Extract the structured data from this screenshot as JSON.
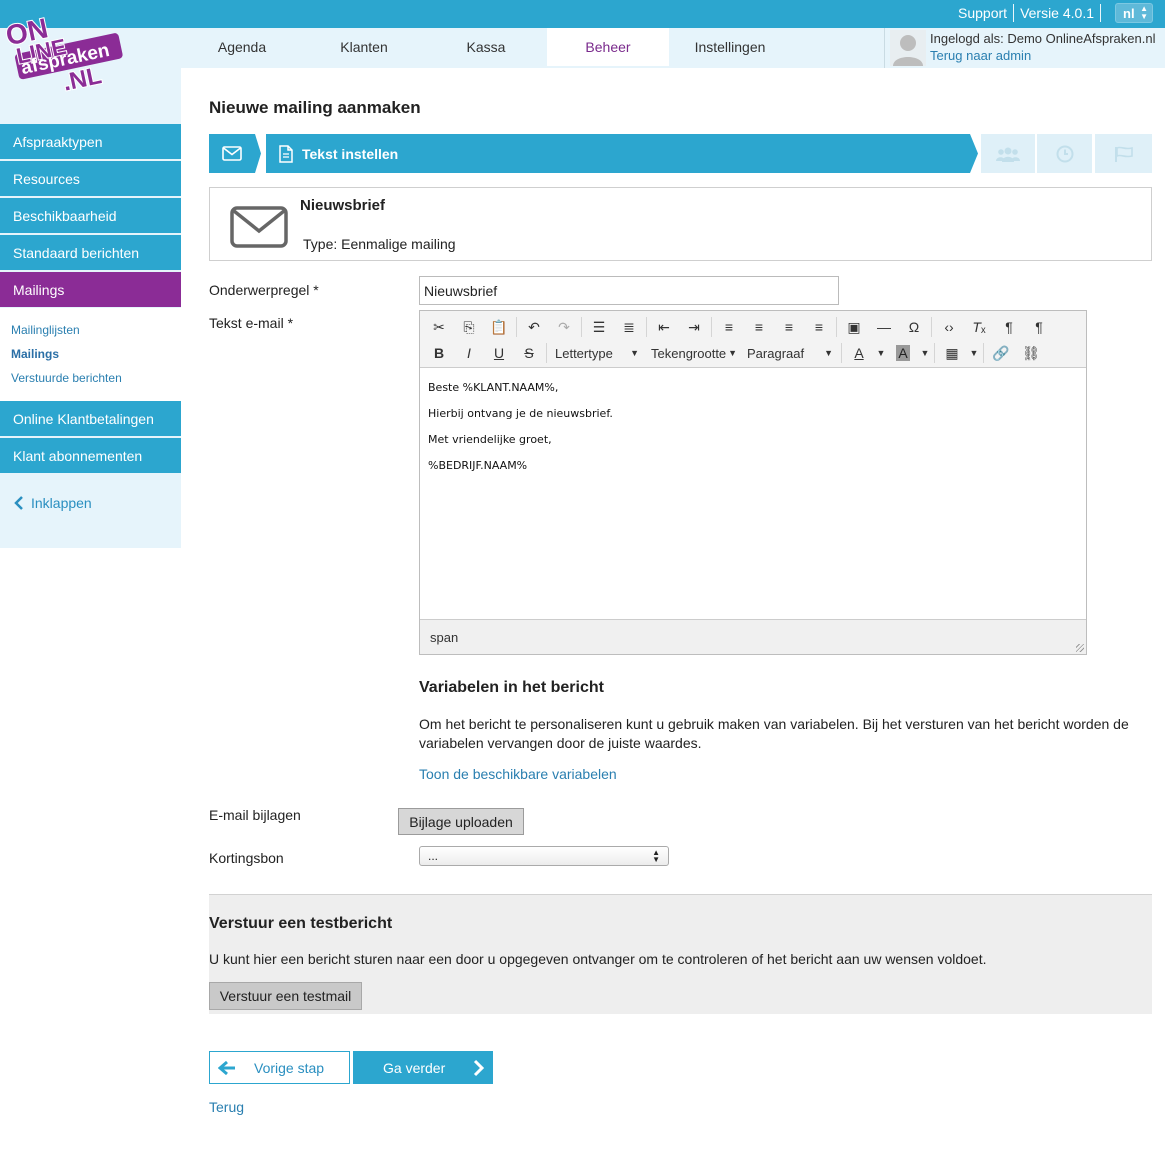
{
  "topbar": {
    "support": "Support",
    "version": "Versie 4.0.1",
    "language": "nl"
  },
  "logo": {
    "line1": "ON",
    "line2": "LINE",
    "line3": "afspraken",
    "line4": ".NL"
  },
  "nav": {
    "tabs": [
      {
        "label": "Agenda"
      },
      {
        "label": "Klanten"
      },
      {
        "label": "Kassa"
      },
      {
        "label": "Beheer"
      },
      {
        "label": "Instellingen"
      }
    ],
    "active": "Beheer"
  },
  "user": {
    "logged_in": "Ingelogd als: Demo OnlineAfspraken.nl",
    "back_to_admin": "Terug naar admin"
  },
  "sidebar": {
    "items": [
      {
        "label": "Afspraaktypen"
      },
      {
        "label": "Resources"
      },
      {
        "label": "Beschikbaarheid"
      },
      {
        "label": "Standaard berichten"
      },
      {
        "label": "Mailings"
      },
      {
        "label": "Online Klantbetalingen"
      },
      {
        "label": "Klant abonnementen"
      }
    ],
    "subitems": [
      {
        "label": "Mailinglijsten"
      },
      {
        "label": "Mailings"
      },
      {
        "label": "Verstuurde berichten"
      }
    ],
    "collapse": "Inklappen"
  },
  "page": {
    "title": "Nieuwe mailing aanmaken",
    "step_label": "Tekst instellen"
  },
  "card": {
    "name": "Nieuwsbrief",
    "type": "Type: Eenmalige mailing"
  },
  "form": {
    "subject_label": "Onderwerpregel *",
    "subject_value": "Nieuwsbrief",
    "body_label": "Tekst e-mail *",
    "attachments_label": "E-mail bijlagen",
    "upload_button": "Bijlage uploaden",
    "coupon_label": "Kortingsbon",
    "coupon_value": "..."
  },
  "editor": {
    "font_dropdown": "Lettertype",
    "size_dropdown": "Tekengrootte",
    "format_dropdown": "Paragraaf",
    "lines": [
      "Beste %KLANT.NAAM%,",
      "Hierbij ontvang je de nieuwsbrief.",
      "Met vriendelijke groet,",
      "%BEDRIJF.NAAM%"
    ],
    "statusbar": "span"
  },
  "variables": {
    "title": "Variabelen in het bericht",
    "text": "Om het bericht te personaliseren kunt u gebruik maken van variabelen. Bij het versturen van het bericht worden de variabelen vervangen door de juiste waardes.",
    "link": "Toon de beschikbare variabelen"
  },
  "test": {
    "title": "Verstuur een testbericht",
    "text": "U kunt hier een bericht sturen naar een door u opgegeven ontvanger om te controleren of het bericht aan uw wensen voldoet.",
    "button": "Verstuur een testmail"
  },
  "footer": {
    "prev": "Vorige stap",
    "next": "Ga verder",
    "back": "Terug"
  },
  "colors": {
    "primary": "#2ca6cf",
    "active_purple": "#8b2c96",
    "light_bg": "#e6f4fb"
  }
}
